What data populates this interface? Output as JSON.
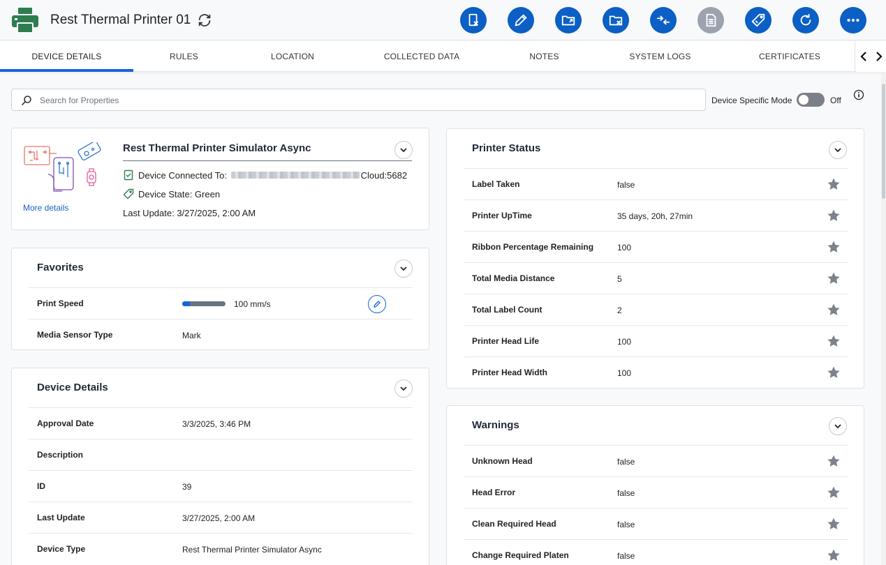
{
  "header": {
    "title": "Rest Thermal Printer 01",
    "actions": [
      "remove-device-icon",
      "edit-icon",
      "export-icon",
      "delete-folder-icon",
      "compare-icon",
      "document-icon",
      "tag-icon",
      "restart-icon",
      "more-icon"
    ]
  },
  "tabs": [
    {
      "label": "DEVICE DETAILS",
      "active": true
    },
    {
      "label": "RULES"
    },
    {
      "label": "LOCATION"
    },
    {
      "label": "COLLECTED DATA"
    },
    {
      "label": "NOTES"
    },
    {
      "label": "SYSTEM LOGS"
    },
    {
      "label": "CERTIFICATES"
    }
  ],
  "search": {
    "placeholder": "Search for Properties"
  },
  "mode": {
    "label": "Device Specific Mode",
    "state": "Off"
  },
  "overview": {
    "title": "Rest Thermal Printer Simulator Async",
    "connected_label": "Device Connected To:",
    "connected_suffix": "Cloud:5682",
    "state": "Device State: Green",
    "last_update": "Last Update: 3/27/2025, 2:00 AM",
    "more_details": "More details"
  },
  "favorites": {
    "title": "Favorites",
    "rows": [
      {
        "key": "Print Speed",
        "value": "100 mm/s",
        "progress": 0.18
      },
      {
        "key": "Media Sensor Type",
        "value": "Mark"
      }
    ]
  },
  "device_details": {
    "title": "Device Details",
    "rows": [
      {
        "key": "Approval Date",
        "value": "3/3/2025, 3:46 PM"
      },
      {
        "key": "Description",
        "value": ""
      },
      {
        "key": "ID",
        "value": "39"
      },
      {
        "key": "Last Update",
        "value": "3/27/2025, 2:00 AM"
      },
      {
        "key": "Device Type",
        "value": "Rest Thermal Printer Simulator Async"
      }
    ]
  },
  "printer_status": {
    "title": "Printer Status",
    "rows": [
      {
        "key": "Label Taken",
        "value": "false"
      },
      {
        "key": "Printer UpTime",
        "value": "35 days, 20h, 27min"
      },
      {
        "key": "Ribbon Percentage Remaining",
        "value": "100"
      },
      {
        "key": "Total Media Distance",
        "value": "5"
      },
      {
        "key": "Total Label Count",
        "value": "2"
      },
      {
        "key": "Printer Head Life",
        "value": "100"
      },
      {
        "key": "Printer Head Width",
        "value": "100"
      }
    ]
  },
  "warnings": {
    "title": "Warnings",
    "rows": [
      {
        "key": "Unknown Head",
        "value": "false"
      },
      {
        "key": "Head Error",
        "value": "false"
      },
      {
        "key": "Clean Required Head",
        "value": "false"
      },
      {
        "key": "Change Required Platen",
        "value": "false"
      }
    ]
  },
  "colors": {
    "accent": "#0b5fc5",
    "disabled": "#9ca3af",
    "brand_icon": "#2e7d4f"
  }
}
